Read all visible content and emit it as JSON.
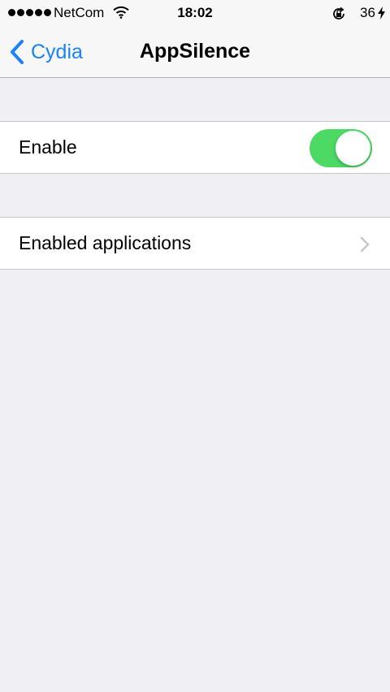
{
  "status_bar": {
    "carrier": "NetCom",
    "time": "18:02",
    "battery": "36"
  },
  "nav": {
    "back_label": "Cydia",
    "title": "AppSilence"
  },
  "settings": {
    "enable_label": "Enable",
    "enable_on": true,
    "enabled_apps_label": "Enabled applications"
  },
  "colors": {
    "accent": "#1a82fb",
    "toggle_on": "#4cd964",
    "background": "#efeff4"
  },
  "icons": [
    "signal-dots-icon",
    "wifi-icon",
    "rotation-lock-icon",
    "charging-bolt-icon",
    "back-chevron-icon",
    "disclosure-chevron-icon"
  ]
}
